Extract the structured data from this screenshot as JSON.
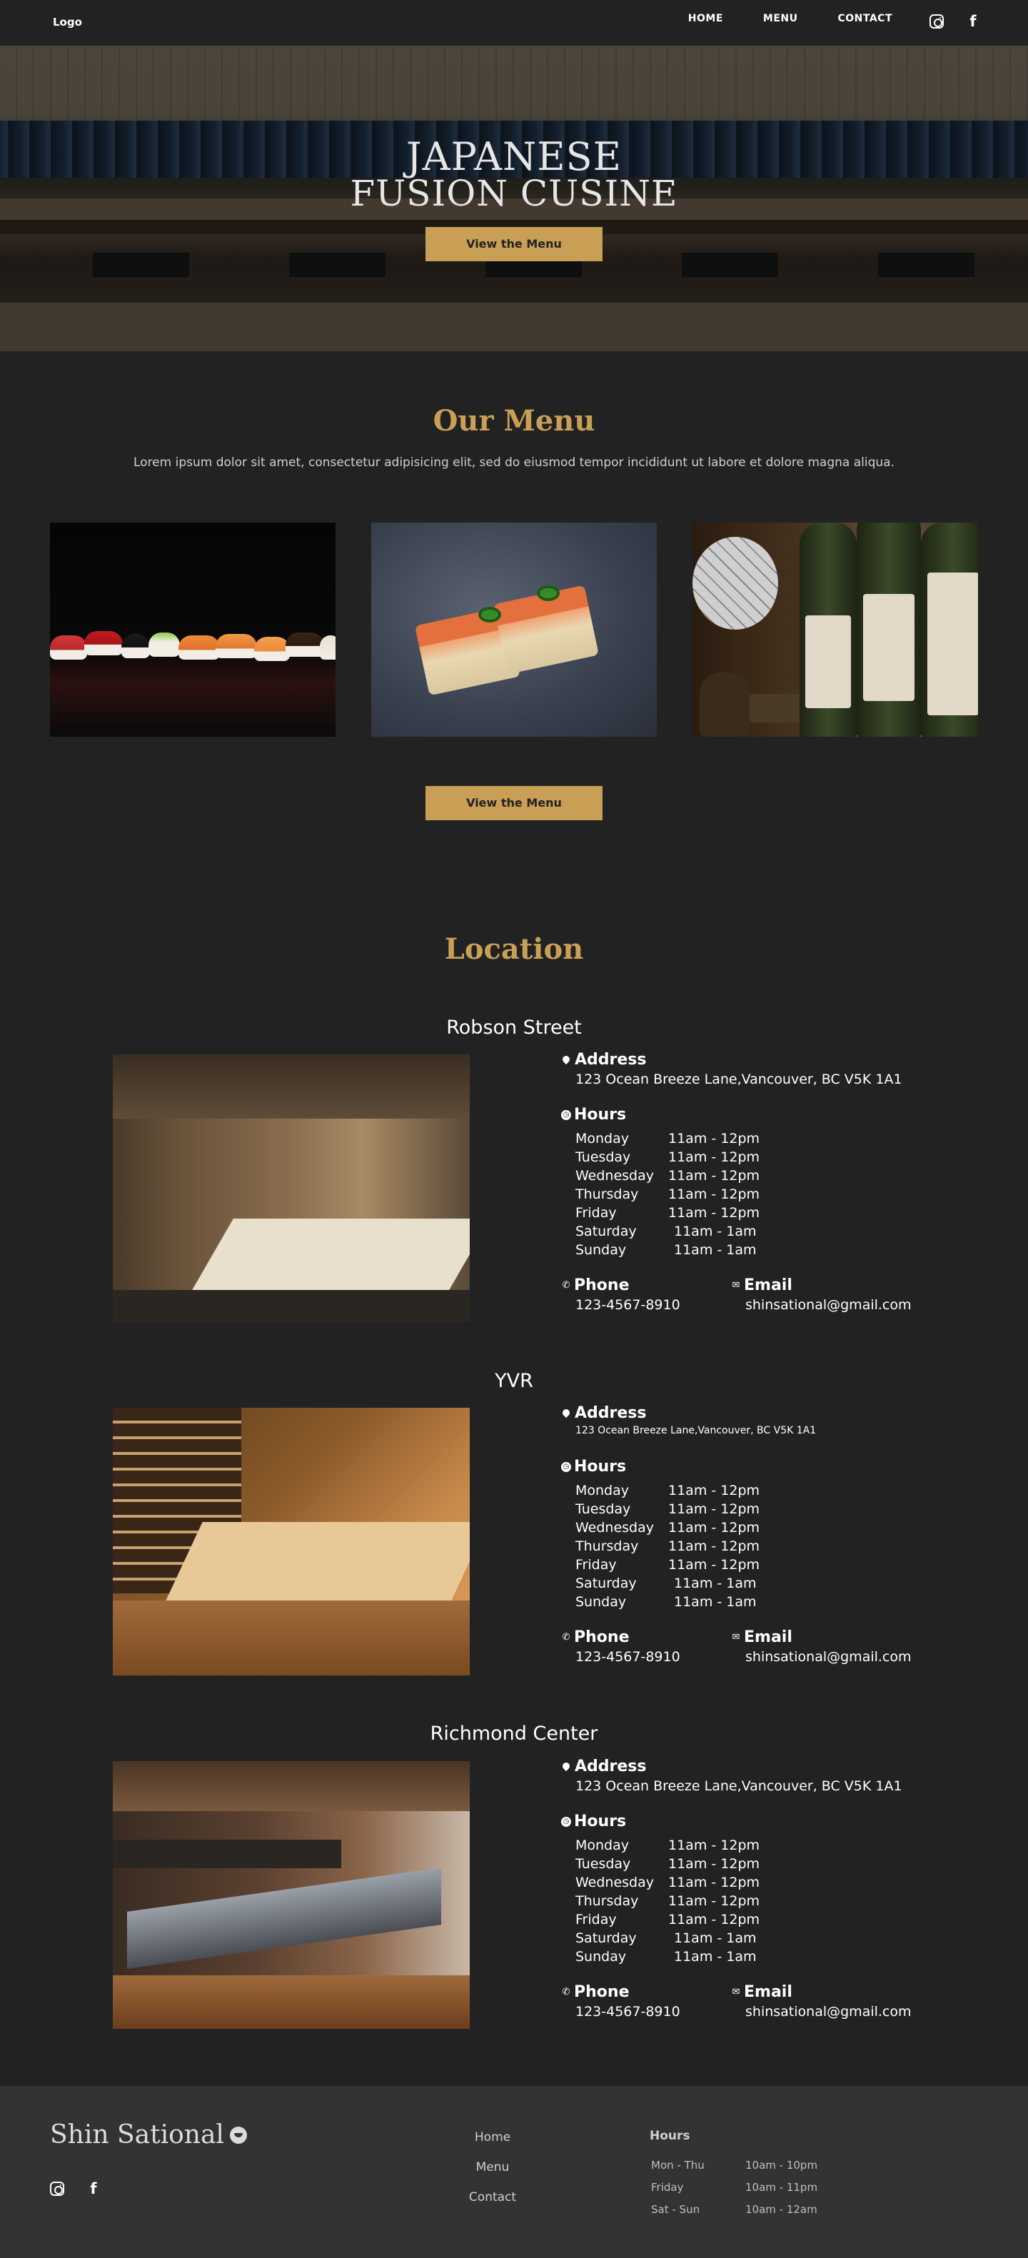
{
  "nav": {
    "logo": "Logo",
    "links": [
      "HOME",
      "MENU",
      "CONTACT"
    ],
    "social": [
      "instagram-icon",
      "facebook-icon"
    ]
  },
  "hero": {
    "title_line1": "JAPANESE",
    "title_line2": "FUSION CUSINE",
    "button": "View the Menu"
  },
  "menu": {
    "title": "Our Menu",
    "description": "Lorem ipsum dolor sit amet, consectetur adipisicing elit, sed do eiusmod tempor incididunt ut labore et dolore magna aliqua.",
    "button": "View the Menu"
  },
  "location": {
    "title": "Location",
    "labels": {
      "address": "Address",
      "hours": "Hours",
      "phone": "Phone",
      "email": "Email"
    },
    "branches": [
      {
        "name": "Robson Street",
        "address": "123 Ocean Breeze Lane,Vancouver, BC V5K 1A1",
        "hours": [
          [
            "Monday",
            "11am - 12pm"
          ],
          [
            "Tuesday",
            "11am - 12pm"
          ],
          [
            "Wednesday",
            "11am - 12pm"
          ],
          [
            "Thursday",
            "11am - 12pm"
          ],
          [
            "Friday",
            "11am - 12pm"
          ],
          [
            "Saturday",
            " 11am - 1am"
          ],
          [
            "Sunday",
            " 11am - 1am"
          ]
        ],
        "phone": "123-4567-8910",
        "email": "shinsational@gmail.com"
      },
      {
        "name": "YVR",
        "address": "123 Ocean Breeze Lane,Vancouver, BC V5K 1A1",
        "hours": [
          [
            "Monday",
            "11am - 12pm"
          ],
          [
            "Tuesday",
            "11am - 12pm"
          ],
          [
            "Wednesday",
            "11am - 12pm"
          ],
          [
            "Thursday",
            "11am - 12pm"
          ],
          [
            "Friday",
            "11am - 12pm"
          ],
          [
            "Saturday",
            " 11am - 1am"
          ],
          [
            "Sunday",
            " 11am - 1am"
          ]
        ],
        "phone": "123-4567-8910",
        "email": "shinsational@gmail.com"
      },
      {
        "name": "Richmond Center",
        "address": "123 Ocean Breeze Lane,Vancouver, BC V5K 1A1",
        "hours": [
          [
            "Monday",
            "11am - 12pm"
          ],
          [
            "Tuesday",
            "11am - 12pm"
          ],
          [
            "Wednesday",
            "11am - 12pm"
          ],
          [
            "Thursday",
            "11am - 12pm"
          ],
          [
            "Friday",
            "11am - 12pm"
          ],
          [
            "Saturday",
            " 11am - 1am"
          ],
          [
            "Sunday",
            " 11am - 1am"
          ]
        ],
        "phone": "123-4567-8910",
        "email": "shinsational@gmail.com"
      }
    ]
  },
  "footer": {
    "brand": "Shin Sational",
    "links": [
      "Home",
      "Menu",
      "Contact"
    ],
    "hours_title": "Hours",
    "hours": [
      [
        "Mon - Thu",
        "10am - 10pm"
      ],
      [
        "Friday",
        "10am - 11pm"
      ],
      [
        "Sat - Sun",
        "10am - 12am"
      ]
    ]
  },
  "colors": {
    "background": "#222222",
    "accent": "#c89f55",
    "footer": "#333333"
  }
}
